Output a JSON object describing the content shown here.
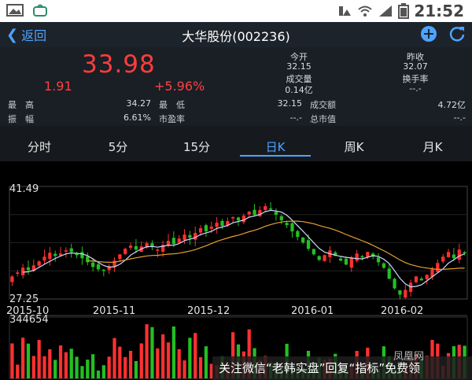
{
  "status": {
    "time": "21:52"
  },
  "nav": {
    "back_label": "返回",
    "title": "大华股份(002236)"
  },
  "quote": {
    "price": "33.98",
    "change": "1.91",
    "change_pct": "+5.96%",
    "open_label": "今开",
    "open": "32.15",
    "prev_close_label": "昨收",
    "prev_close": "32.07",
    "volume_label": "成交量",
    "volume": "0.14亿",
    "turnover_label": "换手率",
    "turnover": "--.-",
    "high_label": "最　高",
    "high": "34.27",
    "low_label": "最　低",
    "low": "32.15",
    "amount_label": "成交额",
    "amount": "4.72亿",
    "amplitude_label": "振　幅",
    "amplitude": "6.61%",
    "pe_label": "市盈率",
    "pe": "--.-",
    "mktcap_label": "总市值",
    "mktcap": "--.-"
  },
  "tabs": [
    "分时",
    "5分",
    "15分",
    "日K",
    "周K",
    "月K"
  ],
  "active_tab": 3,
  "chart": {
    "y_max_label": "41.49",
    "y_min_label": "27.25",
    "vol_max_label": "344654",
    "x_labels": [
      "2015-10",
      "2015-11",
      "2015-12",
      "2016-01",
      "2016-02"
    ]
  },
  "watermark": {
    "text": "关注微信“老韩实盘”回复“指标”免费领",
    "brand": "凤凰网"
  },
  "colors": {
    "up": "#ff3030",
    "down": "#22c022",
    "accent": "#4da3ff",
    "ma1": "#ffffff",
    "ma2": "#e6a030"
  },
  "chart_data": {
    "type": "candlestick",
    "price_range": [
      27.25,
      41.49
    ],
    "volume_max": 344654,
    "x_ticks": [
      "2015-10",
      "2015-11",
      "2015-12",
      "2016-01",
      "2016-02"
    ],
    "close": [
      30.1,
      30.6,
      31.2,
      30.9,
      31.5,
      32.0,
      32.6,
      33.1,
      32.7,
      33.0,
      33.4,
      33.2,
      32.8,
      32.4,
      31.9,
      31.3,
      31.0,
      30.8,
      31.4,
      32.1,
      32.9,
      33.6,
      34.0,
      33.5,
      33.9,
      34.3,
      33.8,
      33.5,
      34.1,
      34.6,
      34.2,
      34.9,
      35.4,
      35.0,
      35.6,
      36.2,
      35.8,
      36.4,
      36.9,
      36.5,
      37.1,
      37.6,
      37.2,
      37.8,
      38.3,
      37.9,
      38.5,
      39.0,
      38.6,
      37.9,
      37.2,
      36.6,
      35.8,
      35.1,
      34.4,
      33.6,
      32.9,
      32.2,
      32.8,
      33.4,
      32.7,
      32.1,
      31.6,
      32.4,
      33.0,
      32.5,
      33.2,
      32.6,
      31.9,
      31.2,
      29.8,
      28.6,
      27.8,
      28.4,
      29.3,
      30.1,
      29.6,
      30.3,
      31.0,
      31.8,
      32.6,
      33.2,
      32.4,
      33.5,
      33.1
    ]
  }
}
